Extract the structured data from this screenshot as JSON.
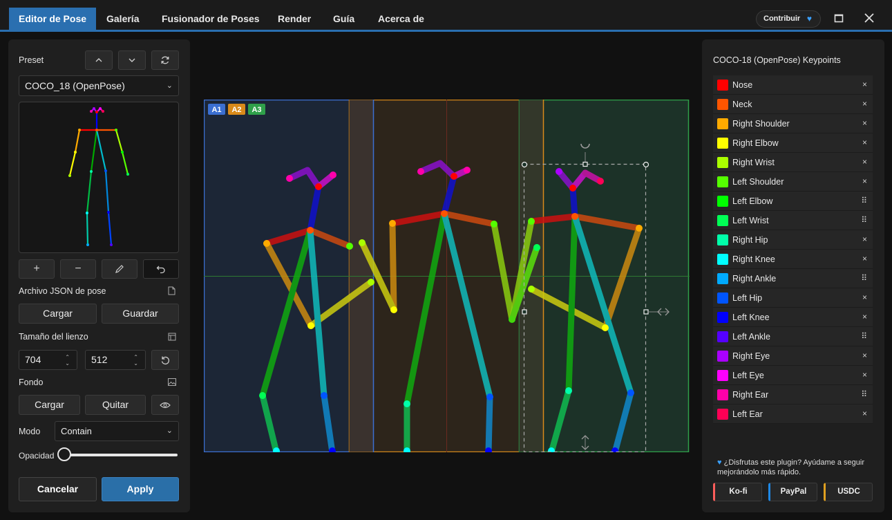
{
  "tabs": [
    {
      "label": "Editor de Pose",
      "active": true
    },
    {
      "label": "Galería"
    },
    {
      "label": "Fusionador de Poses"
    },
    {
      "label": "Render"
    },
    {
      "label": "Guía"
    },
    {
      "label": "Acerca de"
    }
  ],
  "header": {
    "contribute_label": "Contribuir"
  },
  "left": {
    "preset_label": "Preset",
    "preset_value": "COCO_18 (OpenPose)",
    "json_label": "Archivo JSON de pose",
    "load_label": "Cargar",
    "save_label": "Guardar",
    "canvas_size_label": "Tamaño del lienzo",
    "width": "704",
    "height": "512",
    "background_label": "Fondo",
    "bg_load_label": "Cargar",
    "bg_remove_label": "Quitar",
    "mode_label": "Modo",
    "mode_value": "Contain",
    "opacity_label": "Opacidad",
    "opacity_value": 0,
    "cancel_label": "Cancelar",
    "apply_label": "Apply"
  },
  "canvas": {
    "areas": [
      "A1",
      "A2",
      "A3"
    ],
    "area_colors": [
      "#3b6fd1",
      "#d98a1a",
      "#2fa04a"
    ]
  },
  "right": {
    "title": "COCO-18 (OpenPose) Keypoints",
    "keypoints": [
      {
        "name": "Nose",
        "color": "#ff0000",
        "action": "×"
      },
      {
        "name": "Neck",
        "color": "#ff5500",
        "action": "×"
      },
      {
        "name": "Right Shoulder",
        "color": "#ffaa00",
        "action": "×"
      },
      {
        "name": "Right Elbow",
        "color": "#ffff00",
        "action": "×"
      },
      {
        "name": "Right Wrist",
        "color": "#aaff00",
        "action": "×"
      },
      {
        "name": "Left Shoulder",
        "color": "#55ff00",
        "action": "×"
      },
      {
        "name": "Left Elbow",
        "color": "#00ff00",
        "action": "⠿"
      },
      {
        "name": "Left Wrist",
        "color": "#00ff55",
        "action": "⠿"
      },
      {
        "name": "Right Hip",
        "color": "#00ffaa",
        "action": "×"
      },
      {
        "name": "Right Knee",
        "color": "#00ffff",
        "action": "×"
      },
      {
        "name": "Right Ankle",
        "color": "#00aaff",
        "action": "⠿"
      },
      {
        "name": "Left Hip",
        "color": "#0055ff",
        "action": "×"
      },
      {
        "name": "Left Knee",
        "color": "#0000ff",
        "action": "×"
      },
      {
        "name": "Left Ankle",
        "color": "#5500ff",
        "action": "⠿"
      },
      {
        "name": "Right Eye",
        "color": "#aa00ff",
        "action": "×"
      },
      {
        "name": "Left Eye",
        "color": "#ff00ff",
        "action": "×"
      },
      {
        "name": "Right Ear",
        "color": "#ff00aa",
        "action": "⠿"
      },
      {
        "name": "Left Ear",
        "color": "#ff0055",
        "action": "×"
      }
    ],
    "support_text": "¿Disfrutas este plugin? Ayúdame a seguir mejorándolo más rápido.",
    "donate": [
      {
        "label": "Ko-fi",
        "color": "#ff5e5b"
      },
      {
        "label": "PayPal",
        "color": "#1e88e5"
      },
      {
        "label": "USDC",
        "color": "#e0a020"
      }
    ]
  }
}
